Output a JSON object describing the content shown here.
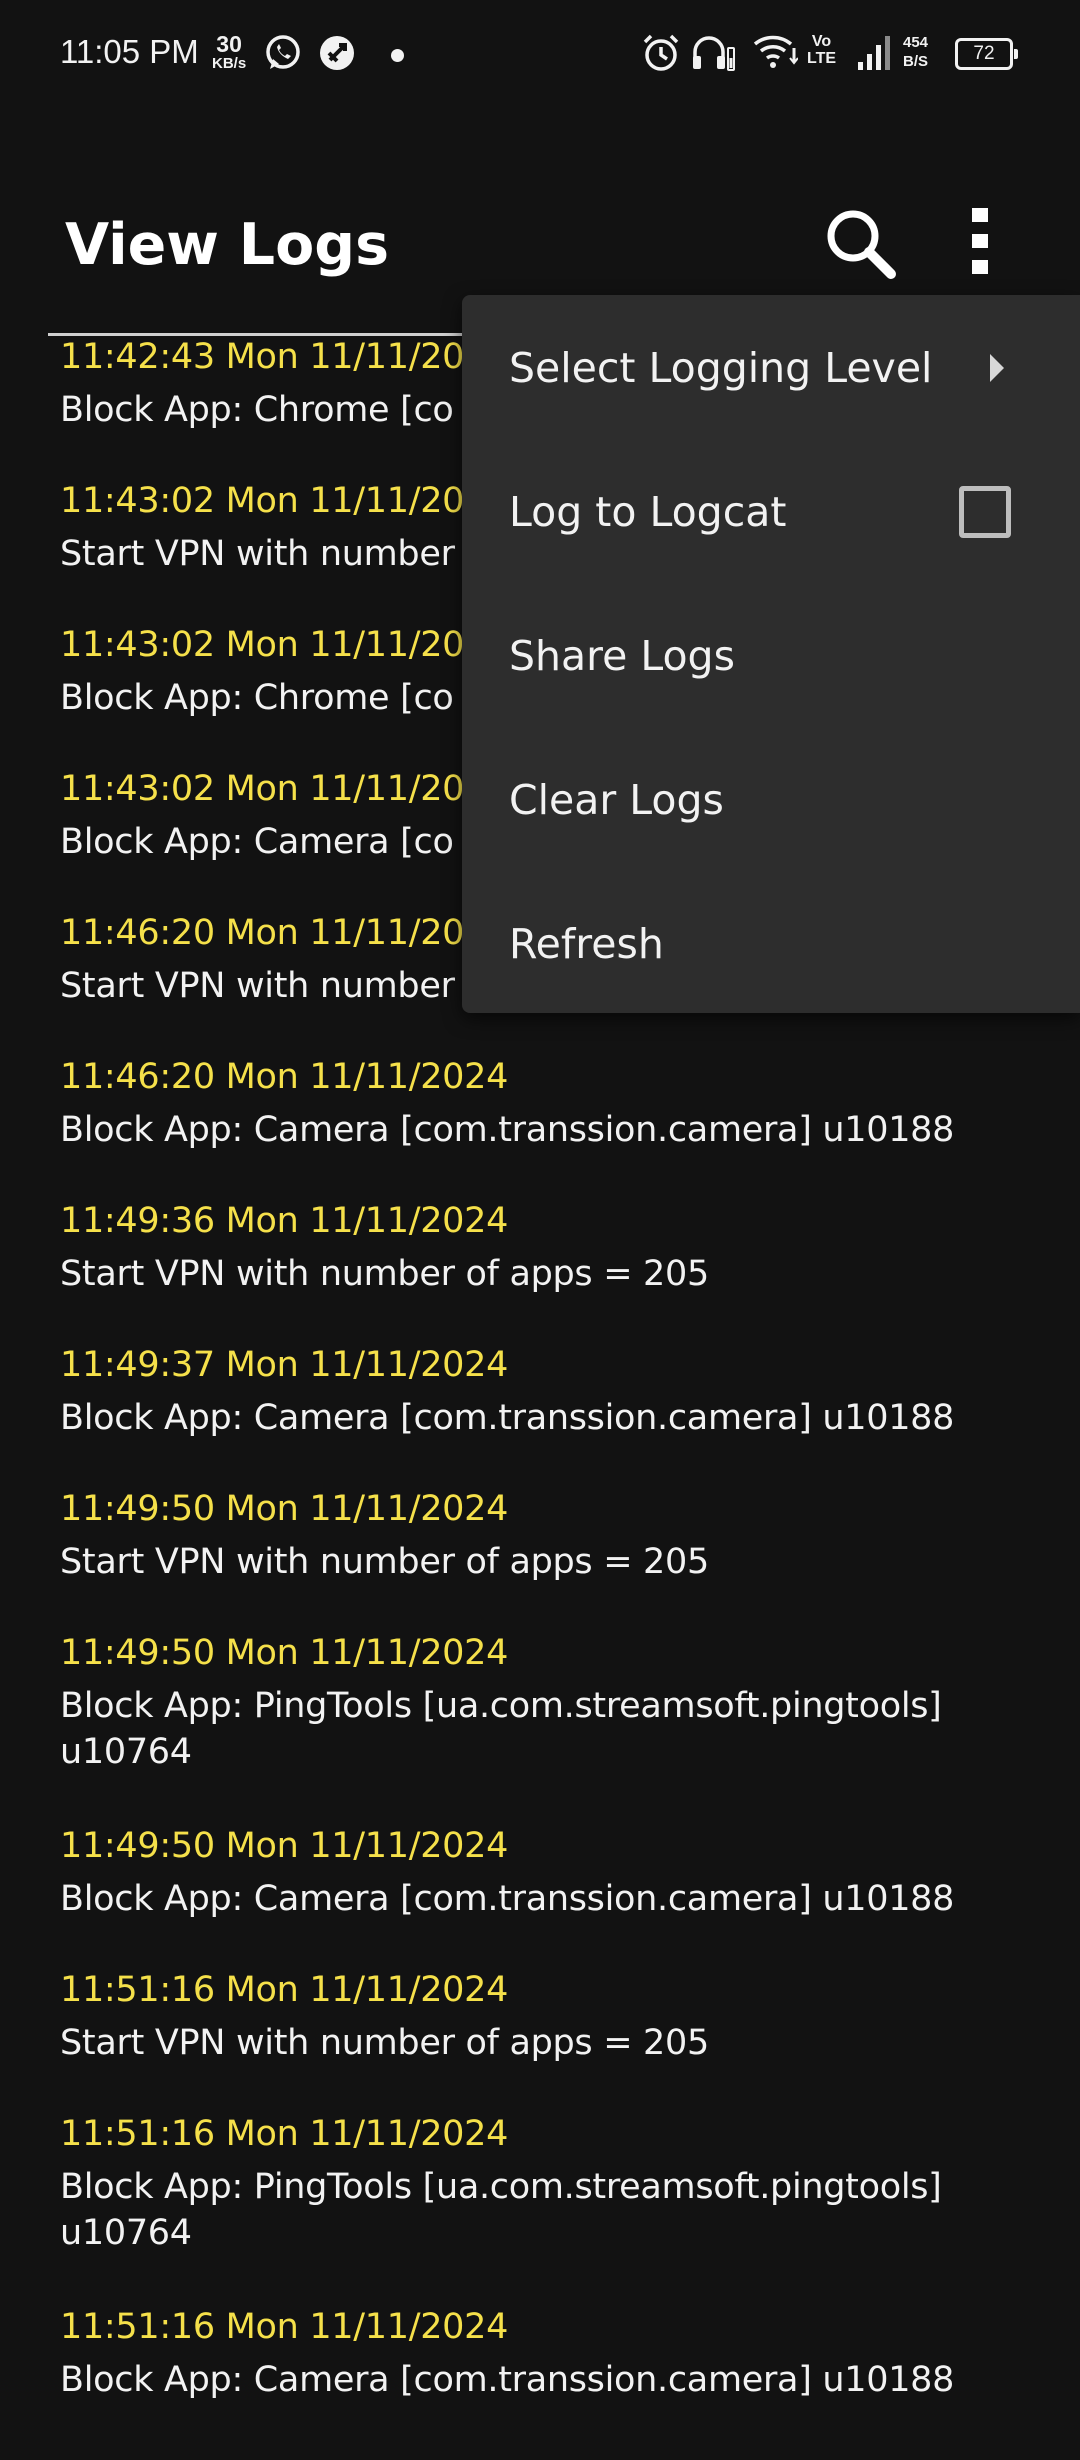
{
  "status_bar": {
    "time": "11:05 PM",
    "data_speed_value": "30",
    "data_speed_unit": "KB/s",
    "net_speed_value": "454",
    "net_speed_unit": "B/S",
    "volte_top": "Vo",
    "volte_bottom": "LTE",
    "battery_level": "72",
    "icons": [
      "whatsapp-icon",
      "vpn-app-icon",
      "notification-dot",
      "alarm-icon",
      "headset-icon",
      "wifi-icon",
      "volte-icon",
      "signal-icon",
      "battery-icon"
    ]
  },
  "app_bar": {
    "title": "View Logs",
    "search_icon": "search-icon",
    "more_icon": "more-vert-icon"
  },
  "colors": {
    "background": "#121212",
    "timestamp": "#f5e04a",
    "text": "#f2f2f2",
    "menu_background": "#2d2d2d"
  },
  "logs": [
    {
      "timestamp": "11:42:43 Mon 11/11/20",
      "message": "Block App: Chrome [co"
    },
    {
      "timestamp": "11:43:02 Mon 11/11/20",
      "message": "Start VPN with number"
    },
    {
      "timestamp": "11:43:02 Mon 11/11/20",
      "message": "Block App: Chrome [co"
    },
    {
      "timestamp": "11:43:02 Mon 11/11/20",
      "message": "Block App: Camera [co"
    },
    {
      "timestamp": "11:46:20 Mon 11/11/20",
      "message": "Start VPN with number"
    },
    {
      "timestamp": "11:46:20 Mon 11/11/2024",
      "message": "Block App: Camera [com.transsion.camera] u10188"
    },
    {
      "timestamp": "11:49:36 Mon 11/11/2024",
      "message": "Start VPN with number of apps = 205"
    },
    {
      "timestamp": "11:49:37 Mon 11/11/2024",
      "message": "Block App: Camera [com.transsion.camera] u10188"
    },
    {
      "timestamp": "11:49:50 Mon 11/11/2024",
      "message": "Start VPN with number of apps = 205"
    },
    {
      "timestamp": "11:49:50 Mon 11/11/2024",
      "message": "Block App: PingTools [ua.com.streamsoft.pingtools] u10764"
    },
    {
      "timestamp": "11:49:50 Mon 11/11/2024",
      "message": "Block App: Camera [com.transsion.camera] u10188"
    },
    {
      "timestamp": "11:51:16 Mon 11/11/2024",
      "message": "Start VPN with number of apps = 205"
    },
    {
      "timestamp": "11:51:16 Mon 11/11/2024",
      "message": "Block App: PingTools [ua.com.streamsoft.pingtools] u10764"
    },
    {
      "timestamp": "11:51:16 Mon 11/11/2024",
      "message": "Block App: Camera [com.transsion.camera] u10188"
    }
  ],
  "menu": {
    "items": [
      {
        "label": "Select Logging Level",
        "kind": "submenu"
      },
      {
        "label": "Log to Logcat",
        "kind": "checkbox",
        "checked": false
      },
      {
        "label": "Share Logs",
        "kind": "action"
      },
      {
        "label": "Clear Logs",
        "kind": "action"
      },
      {
        "label": "Refresh",
        "kind": "action"
      }
    ]
  }
}
